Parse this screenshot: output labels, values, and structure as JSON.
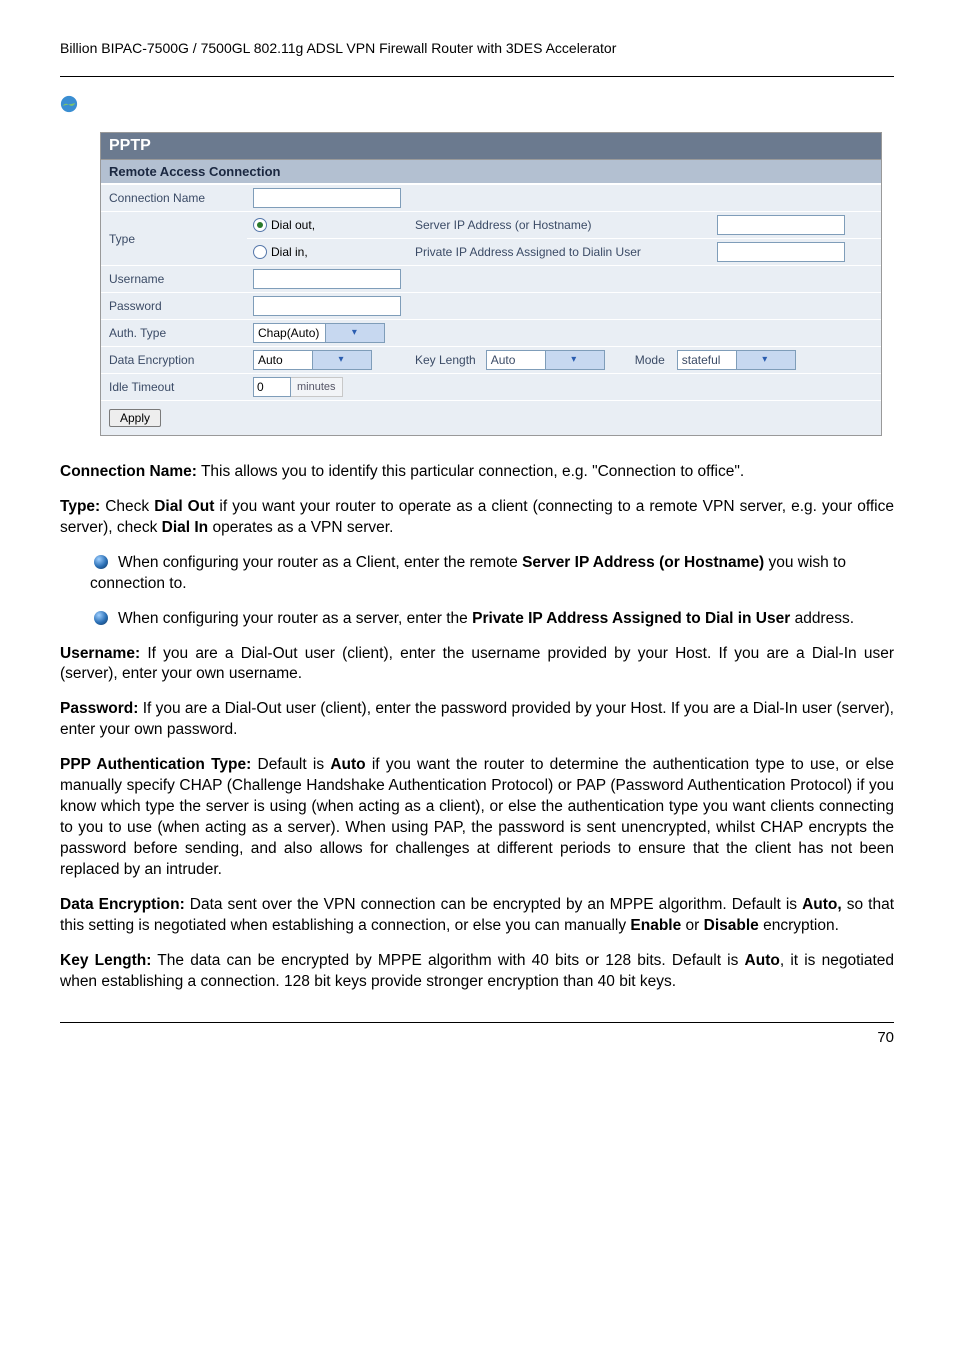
{
  "header": {
    "product": "Billion BIPAC-7500G / 7500GL 802.11g ADSL VPN Firewall Router with 3DES Accelerator"
  },
  "form": {
    "title": "PPTP",
    "subtitle": "Remote Access Connection",
    "rows": {
      "connectionName": {
        "label": "Connection Name",
        "value": ""
      },
      "type": {
        "label": "Type",
        "dialOut": "Dial out,",
        "dialIn": "Dial in,",
        "serverIpLabel": "Server IP Address (or Hostname)",
        "privateIpLabel": "Private IP Address Assigned to Dialin User",
        "serverIpValue": "",
        "privateIpValue": ""
      },
      "username": {
        "label": "Username",
        "value": ""
      },
      "password": {
        "label": "Password",
        "value": ""
      },
      "authType": {
        "label": "Auth. Type",
        "value": "Chap(Auto)"
      },
      "dataEncryption": {
        "label": "Data Encryption",
        "value": "Auto",
        "keyLengthLabel": "Key Length",
        "keyLengthValue": "Auto",
        "modeLabel": "Mode",
        "modeValue": "stateful"
      },
      "idleTimeout": {
        "label": "Idle Timeout",
        "value": "0",
        "unit": "minutes"
      }
    },
    "apply": "Apply"
  },
  "doc": {
    "connName_b": "Connection Name:",
    "connName_t": " This allows you to identify this particular connection, e.g. \"Connection to office\".",
    "type_b": "Type:",
    "type_t1": " Check ",
    "type_b2": "Dial Out",
    "type_t2": " if you want your router to operate as a client (connecting to a remote VPN server, e.g. your office server), check ",
    "type_b3": "Dial In",
    "type_t3": " operates as a VPN server.",
    "bul1a": "When configuring your router as a Client, enter the remote ",
    "bul1b": "Server IP Address (or Hostname)",
    "bul1c": " you wish to connection to.",
    "bul2a": "When configuring your router as a server, enter the ",
    "bul2b": "Private IP Address Assigned to Dial in User",
    "bul2c": " address.",
    "user_b": "Username:",
    "user_t": " If you are a Dial-Out user (client), enter the username provided by your Host. If you are a Dial-In user (server), enter your own username.",
    "pass_b": "Password:",
    "pass_t": " If you are a Dial-Out user (client), enter the password provided by your Host. If you are a Dial-In user (server), enter your own password.",
    "auth_b": "PPP Authentication Type:",
    "auth_t1": " Default is ",
    "auth_b2": "Auto",
    "auth_t2": " if you want the router to determine the authentication type to use, or else manually specify CHAP (Challenge Handshake Authentication Protocol) or PAP (Password Authentication Protocol) if you know which type the server is using (when acting as a client), or else the authentication type you want clients connecting to you to use (when acting as a server). When using PAP, the password is sent unencrypted, whilst CHAP encrypts the password before sending, and also allows for challenges at different periods to ensure that the client has not been replaced by an intruder.",
    "enc_b": "Data Encryption:",
    "enc_t1": " Data sent over the VPN connection can be encrypted by an MPPE algorithm. Default is ",
    "enc_b2": "Auto,",
    "enc_t2": " so that this setting is negotiated when establishing a connection, or else you can manually ",
    "enc_b3": "Enable",
    "enc_t3": " or ",
    "enc_b4": "Disable",
    "enc_t4": " encryption.",
    "key_b": "Key Length:",
    "key_t1": " The data can be encrypted by MPPE algorithm with 40 bits or 128 bits. Default is ",
    "key_b2": "Auto",
    "key_t2": ", it is negotiated when establishing a connection. 128 bit keys provide stronger encryption than 40 bit keys."
  },
  "footer": {
    "page": "70"
  }
}
